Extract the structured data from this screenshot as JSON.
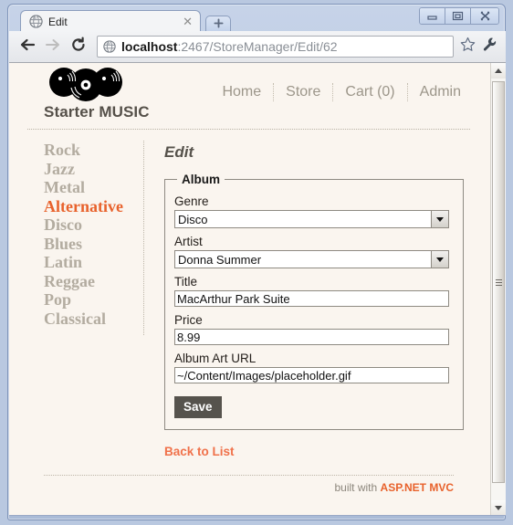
{
  "browser": {
    "tab": {
      "title": "Edit",
      "favicon_icon": "globe-icon",
      "close_icon": "close-icon"
    },
    "new_tab_icon": "plus-icon",
    "window_controls": {
      "minimize_icon": "minimize-icon",
      "maximize_icon": "maximize-icon",
      "close_icon": "window-close-icon"
    },
    "toolbar": {
      "back_icon": "back-arrow-icon",
      "forward_icon": "forward-arrow-icon",
      "reload_icon": "reload-icon",
      "star_icon": "star-icon",
      "wrench_icon": "wrench-icon",
      "omnibox_favicon": "globe-icon",
      "url_host": "localhost",
      "url_rest": ":2467/StoreManager/Edit/62"
    }
  },
  "site": {
    "logo_icon": "vinyl-records-logo",
    "title": "Starter MUSIC",
    "nav": [
      {
        "label": "Home"
      },
      {
        "label": "Store"
      },
      {
        "label": "Cart (0)"
      },
      {
        "label": "Admin"
      }
    ]
  },
  "sidebar": {
    "genres": [
      {
        "label": "Rock",
        "active": false
      },
      {
        "label": "Jazz",
        "active": false
      },
      {
        "label": "Metal",
        "active": false
      },
      {
        "label": "Alternative",
        "active": true
      },
      {
        "label": "Disco",
        "active": false
      },
      {
        "label": "Blues",
        "active": false
      },
      {
        "label": "Latin",
        "active": false
      },
      {
        "label": "Reggae",
        "active": false
      },
      {
        "label": "Pop",
        "active": false
      },
      {
        "label": "Classical",
        "active": false
      }
    ]
  },
  "main": {
    "page_title": "Edit",
    "fieldset_legend": "Album",
    "fields": {
      "genre": {
        "label": "Genre",
        "value": "Disco",
        "type": "select",
        "arrow_icon": "chevron-down-icon"
      },
      "artist": {
        "label": "Artist",
        "value": "Donna Summer",
        "type": "select",
        "arrow_icon": "chevron-down-icon"
      },
      "title": {
        "label": "Title",
        "value": "MacArthur Park Suite",
        "type": "text"
      },
      "price": {
        "label": "Price",
        "value": "8.99",
        "type": "text"
      },
      "album_art_url": {
        "label": "Album Art URL",
        "value": "~/Content/Images/placeholder.gif",
        "type": "text"
      }
    },
    "save_label": "Save",
    "back_to_list_label": "Back to List"
  },
  "footer": {
    "text": "built with ",
    "brand": "ASP.NET MVC"
  },
  "colors": {
    "page_background": "#faf5ef",
    "accent_orange": "#e8622c",
    "link_orange": "#f0714a",
    "muted_text": "#b3aca0",
    "save_button": "#56534d"
  },
  "scrollbar": {
    "up_icon": "scroll-up-arrow-icon",
    "down_icon": "scroll-down-arrow-icon",
    "grip_icon": "scrollbar-grip-icon"
  }
}
